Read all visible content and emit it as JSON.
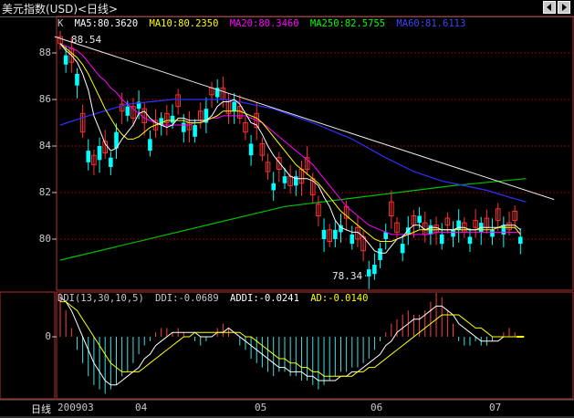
{
  "window": {
    "title": "美元指数(USD)<日线>"
  },
  "legend_main": {
    "k": "K",
    "ma5": "MA5:80.3620",
    "ma10": "MA10:80.2350",
    "ma20": "MA20:80.3460",
    "ma250": "MA250:82.5755",
    "ma60": "MA60:81.6113"
  },
  "legend_ddi": {
    "ddi_params": "DDI(13,30,10,5)",
    "ddi": "DDI:-0.0689",
    "addi": "ADDI:-0.0241",
    "ad": "AD:-0.0140"
  },
  "annotations": {
    "high_label": "88.54",
    "low_label": "78.34"
  },
  "bottom_bar": {
    "period": "日线",
    "x_labels": [
      "200903",
      "04",
      "05",
      "06",
      "07"
    ]
  },
  "colors": {
    "up": "#00ffff",
    "down": "#ff3030",
    "ma5": "#ffffff",
    "ma10": "#ffff00",
    "ma20": "#ff00ff",
    "ma60": "#3030ff",
    "ma250": "#00c000",
    "trendline": "#e8e8e8",
    "grid": "#8b0000",
    "frame": "#b03030"
  },
  "chart_data": {
    "type": "candlestick",
    "price_y_ticks": [
      80,
      82,
      84,
      86,
      88
    ],
    "price_ylim": [
      78,
      89
    ],
    "ddi_y_ticks": [
      0
    ],
    "x_month_labels": [
      "200903",
      "04",
      "05",
      "06",
      "07"
    ],
    "close": [
      88.4,
      87.9,
      87.6,
      87.1,
      84.6,
      83.8,
      83.2,
      84.0,
      83.7,
      83.5,
      84.6,
      85.5,
      85.7,
      85.2,
      85.9,
      85.0,
      84.3,
      84.7,
      85.2,
      85.0,
      85.3,
      85.7,
      85.0,
      84.7,
      84.9,
      85.1,
      85.6,
      86.2,
      86.5,
      86.0,
      85.4,
      85.9,
      85.2,
      84.6,
      84.1,
      84.8,
      83.6,
      82.9,
      82.4,
      83.0,
      82.7,
      82.3,
      82.7,
      82.4,
      83.0,
      81.9,
      81.0,
      80.4,
      79.9,
      80.4,
      80.6,
      80.9,
      80.2,
      80.0,
      79.5,
      78.7,
      78.9,
      79.6,
      80.3,
      81.0,
      80.3,
      79.8,
      80.5,
      80.6,
      81.0,
      80.2,
      80.6,
      80.3,
      80.2,
      80.6,
      80.4,
      80.8,
      80.3,
      80.1,
      80.5,
      80.7,
      80.5,
      80.4,
      80.8,
      80.6,
      80.4,
      80.8,
      80.1
    ],
    "open_offset": [
      0.3,
      -0.4,
      0.6,
      -0.5,
      0.8,
      -0.5,
      0.4,
      -0.6,
      0.5,
      -0.4,
      -0.7,
      0.3,
      -0.4,
      0.5,
      -0.3,
      0.6,
      -0.5,
      0.4,
      -0.3,
      0.4,
      -0.3,
      0.5,
      -0.4,
      0.3,
      -0.5,
      0.4,
      -0.6,
      0.3,
      -0.4,
      0.5,
      0.6,
      -0.4,
      0.5,
      0.4,
      -0.5,
      0.6,
      0.5,
      0.4,
      -0.3,
      0.5,
      -0.3,
      0.4,
      -0.4,
      0.6,
      0.5,
      0.7,
      0.5,
      -0.4,
      0.5,
      -0.4,
      -0.3,
      0.5,
      -0.4,
      0.5,
      0.6,
      -0.3,
      -0.4,
      -0.5,
      -0.3,
      0.6,
      0.4,
      -0.4,
      -0.3,
      0.4,
      -0.3,
      0.5,
      -0.4,
      0.3,
      -0.4,
      0.3,
      -0.3,
      -0.4,
      0.4,
      -0.3,
      0.3,
      -0.4,
      0.4,
      -0.3,
      0.5,
      -0.4,
      0.3,
      0.4,
      -0.3
    ],
    "ma5": [
      88.4,
      88.1,
      87.9,
      87.6,
      87.1,
      86.4,
      85.3,
      84.7,
      84.1,
      83.8,
      83.9,
      84.3,
      84.6,
      84.9,
      85.4,
      85.5,
      85.2,
      85.0,
      84.9,
      84.8,
      84.9,
      85.2,
      85.2,
      85.1,
      85.1,
      85.1,
      85.1,
      85.3,
      85.7,
      85.9,
      85.9,
      86.0,
      85.8,
      85.4,
      85.0,
      84.9,
      84.5,
      84.0,
      83.6,
      83.3,
      83.0,
      82.7,
      82.6,
      82.6,
      82.6,
      82.5,
      82.3,
      81.8,
      81.4,
      80.8,
      80.5,
      80.4,
      80.3,
      80.3,
      80.1,
      79.8,
      79.5,
      79.4,
      79.4,
      79.7,
      80.0,
      80.1,
      80.4,
      80.6,
      80.6,
      80.4,
      80.5,
      80.5,
      80.4,
      80.4,
      80.4,
      80.5,
      80.5,
      80.4,
      80.4,
      80.5,
      80.5,
      80.5,
      80.5,
      80.6,
      80.6,
      80.6,
      80.4
    ],
    "ma10": [
      88.4,
      88.2,
      88.0,
      87.8,
      87.5,
      87.1,
      86.6,
      86.1,
      85.6,
      85.2,
      84.8,
      84.5,
      84.3,
      84.3,
      84.4,
      84.6,
      84.8,
      84.9,
      85.0,
      85.1,
      85.1,
      85.1,
      85.1,
      85.0,
      85.0,
      85.0,
      85.1,
      85.2,
      85.3,
      85.5,
      85.5,
      85.5,
      85.5,
      85.4,
      85.3,
      85.2,
      85.0,
      84.7,
      84.4,
      84.1,
      83.8,
      83.5,
      83.2,
      83.0,
      82.8,
      82.6,
      82.4,
      82.1,
      81.8,
      81.5,
      81.2,
      81.0,
      80.8,
      80.6,
      80.4,
      80.2,
      80.0,
      79.9,
      79.9,
      79.9,
      80.0,
      80.1,
      80.2,
      80.3,
      80.4,
      80.4,
      80.4,
      80.4,
      80.4,
      80.4,
      80.4,
      80.4,
      80.4,
      80.4,
      80.4,
      80.4,
      80.4,
      80.4,
      80.5,
      80.5,
      80.5,
      80.5,
      80.2
    ],
    "ma20": [
      88.4,
      88.3,
      88.2,
      88.1,
      87.9,
      87.6,
      87.3,
      87.0,
      86.8,
      86.5,
      86.3,
      86.0,
      85.8,
      85.6,
      85.4,
      85.2,
      85.1,
      85.0,
      84.9,
      84.9,
      84.9,
      84.9,
      84.9,
      84.9,
      85.0,
      85.0,
      85.1,
      85.2,
      85.2,
      85.3,
      85.3,
      85.3,
      85.3,
      85.3,
      85.2,
      85.1,
      85.0,
      84.8,
      84.6,
      84.4,
      84.2,
      84.0,
      83.8,
      83.6,
      83.4,
      83.2,
      82.9,
      82.6,
      82.3,
      82.0,
      81.7,
      81.4,
      81.2,
      81.0,
      80.8,
      80.6,
      80.5,
      80.4,
      80.3,
      80.2,
      80.2,
      80.2,
      80.2,
      80.2,
      80.2,
      80.2,
      80.2,
      80.3,
      80.3,
      80.3,
      80.3,
      80.3,
      80.3,
      80.3,
      80.3,
      80.3,
      80.3,
      80.3,
      80.3,
      80.3,
      80.3,
      80.3,
      80.3
    ],
    "ma60_points": [
      [
        0,
        84.9
      ],
      [
        5,
        85.3
      ],
      [
        12,
        85.8
      ],
      [
        20,
        86.0
      ],
      [
        30,
        86.0
      ],
      [
        38,
        85.6
      ],
      [
        45,
        85.0
      ],
      [
        52,
        84.3
      ],
      [
        58,
        83.5
      ],
      [
        63,
        82.9
      ],
      [
        68,
        82.5
      ],
      [
        72,
        82.3
      ],
      [
        76,
        82.1
      ],
      [
        80,
        81.8
      ],
      [
        83,
        81.6
      ]
    ],
    "ma250_points": [
      [
        0,
        79.1
      ],
      [
        40,
        81.4
      ],
      [
        70,
        82.3
      ],
      [
        83,
        82.6
      ]
    ],
    "trendline_points": [
      [
        -1,
        88.7
      ],
      [
        88,
        81.7
      ]
    ],
    "ddi": [
      1.0,
      0.6,
      0.2,
      -0.3,
      -0.6,
      -0.9,
      -1.1,
      -1.2,
      -1.3,
      -1.2,
      -1.1,
      -0.9,
      -0.8,
      -0.6,
      -0.4,
      -0.2,
      -0.1,
      0.1,
      0.2,
      0.2,
      0.1,
      0.2,
      0.1,
      0.0,
      -0.1,
      -0.2,
      -0.1,
      0.0,
      0.2,
      0.3,
      0.2,
      0.0,
      -0.2,
      -0.3,
      -0.5,
      -0.6,
      -0.7,
      -0.8,
      -0.9,
      -0.8,
      -0.8,
      -0.9,
      -0.9,
      -1.0,
      -1.0,
      -1.1,
      -1.2,
      -1.1,
      -1.0,
      -0.9,
      -0.8,
      -0.8,
      -0.7,
      -0.7,
      -0.6,
      -0.5,
      -0.3,
      -0.1,
      0.1,
      0.3,
      0.4,
      0.5,
      0.6,
      0.5,
      0.5,
      0.6,
      0.8,
      1.0,
      0.9,
      0.6,
      0.3,
      -0.1,
      -0.2,
      -0.2,
      -0.1,
      -0.2,
      -0.2,
      -0.1,
      0.0,
      0.1,
      0.2,
      0.1,
      0.0
    ],
    "addi": [
      0.9,
      0.8,
      0.6,
      0.3,
      0.0,
      -0.3,
      -0.6,
      -0.8,
      -1.0,
      -1.1,
      -1.1,
      -1.0,
      -0.9,
      -0.8,
      -0.7,
      -0.5,
      -0.4,
      -0.2,
      -0.1,
      0.0,
      0.1,
      0.1,
      0.1,
      0.1,
      0.1,
      0.0,
      0.0,
      0.0,
      0.1,
      0.1,
      0.2,
      0.1,
      0.0,
      -0.1,
      -0.2,
      -0.3,
      -0.4,
      -0.5,
      -0.6,
      -0.7,
      -0.7,
      -0.8,
      -0.8,
      -0.8,
      -0.9,
      -0.9,
      -1.0,
      -1.0,
      -1.0,
      -1.0,
      -0.9,
      -0.9,
      -0.8,
      -0.8,
      -0.7,
      -0.6,
      -0.5,
      -0.4,
      -0.2,
      -0.1,
      0.1,
      0.2,
      0.3,
      0.4,
      0.4,
      0.5,
      0.6,
      0.7,
      0.7,
      0.6,
      0.5,
      0.3,
      0.2,
      0.1,
      0.0,
      -0.1,
      -0.1,
      -0.1,
      -0.1,
      0.0,
      0.0,
      0.0,
      0.0
    ],
    "ad": [
      0.8,
      0.8,
      0.7,
      0.6,
      0.4,
      0.2,
      0.0,
      -0.2,
      -0.4,
      -0.6,
      -0.7,
      -0.8,
      -0.8,
      -0.8,
      -0.8,
      -0.7,
      -0.6,
      -0.5,
      -0.4,
      -0.3,
      -0.2,
      -0.1,
      0.0,
      0.0,
      0.1,
      0.1,
      0.1,
      0.1,
      0.1,
      0.1,
      0.1,
      0.1,
      0.1,
      0.0,
      0.0,
      -0.1,
      -0.2,
      -0.3,
      -0.4,
      -0.5,
      -0.5,
      -0.6,
      -0.6,
      -0.7,
      -0.7,
      -0.8,
      -0.8,
      -0.9,
      -0.9,
      -0.9,
      -0.9,
      -0.9,
      -0.9,
      -0.8,
      -0.8,
      -0.7,
      -0.7,
      -0.6,
      -0.5,
      -0.4,
      -0.3,
      -0.2,
      -0.1,
      0.0,
      0.1,
      0.2,
      0.3,
      0.4,
      0.5,
      0.5,
      0.5,
      0.5,
      0.4,
      0.3,
      0.2,
      0.2,
      0.1,
      0.0,
      0.0,
      0.0,
      0.0,
      0.0,
      0.0
    ]
  }
}
